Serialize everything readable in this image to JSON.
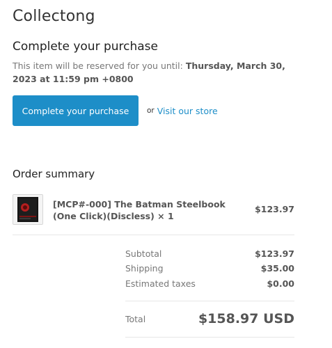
{
  "shop": {
    "name": "Collectong"
  },
  "checkout": {
    "heading": "Complete your purchase",
    "reserve_text": "This item will be reserved for you until:",
    "reserve_until": "Thursday, March 30, 2023 at 11:59 pm +0800",
    "cta_label": "Complete your purchase",
    "or_text": "or",
    "store_link_label": "Visit our store",
    "colors": {
      "accent": "#1d8ec8",
      "text": "#333333",
      "muted": "#777777"
    }
  },
  "order_summary": {
    "title": "Order summary",
    "items": [
      {
        "name": "[MCP#-000] The Batman Steelbook (One Click)(Discless) × 1",
        "price": "$123.97",
        "thumbnail_icon": "steelbook-product-image"
      }
    ],
    "subtotal_label": "Subtotal",
    "subtotal_value": "$123.97",
    "shipping_label": "Shipping",
    "shipping_value": "$35.00",
    "taxes_label": "Estimated taxes",
    "taxes_value": "$0.00",
    "total_label": "Total",
    "total_value": "$158.97 USD"
  }
}
